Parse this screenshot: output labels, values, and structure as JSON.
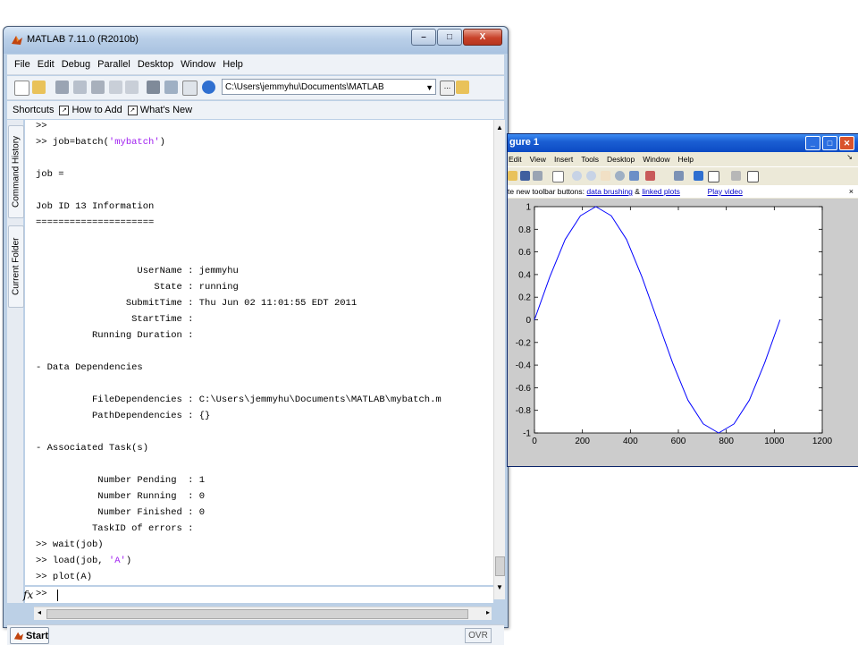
{
  "matlab": {
    "title": "MATLAB  7.11.0 (R2010b)",
    "window_buttons": {
      "minimize": "–",
      "maximize": "□",
      "close": "X"
    },
    "menus": [
      "File",
      "Edit",
      "Debug",
      "Parallel",
      "Desktop",
      "Window",
      "Help"
    ],
    "toolbar": {
      "current_folder": "C:\\Users\\jemmyhu\\Documents\\MATLAB",
      "browse": "..."
    },
    "shortcuts": {
      "label": "Shortcuts",
      "items": [
        "How to Add",
        "What's New"
      ]
    },
    "side_tabs": [
      "Command History",
      "Current Folder"
    ],
    "command_window": {
      "lines": [
        ">>",
        ">> job=batch('mybatch')",
        "",
        "job =",
        "",
        "Job ID 13 Information",
        "=====================",
        "",
        "",
        "                  UserName : jemmyhu",
        "                     State : running",
        "                SubmitTime : Thu Jun 02 11:01:55 EDT 2011",
        "                 StartTime :",
        "          Running Duration :",
        "",
        "- Data Dependencies",
        "",
        "          FileDependencies : C:\\Users\\jemmyhu\\Documents\\MATLAB\\mybatch.m",
        "          PathDependencies : {}",
        "",
        "- Associated Task(s)",
        "",
        "           Number Pending  : 1",
        "           Number Running  : 0",
        "           Number Finished : 0",
        "          TaskID of errors :",
        ">> wait(job)",
        ">> load(job, 'A')",
        ">> plot(A)"
      ],
      "prompt_fx": "fx",
      "prompt": ">>"
    },
    "status": {
      "start_label": "Start",
      "ovr": "OVR"
    }
  },
  "figure": {
    "title": "gure 1",
    "menus": [
      "Edit",
      "View",
      "Insert",
      "Tools",
      "Desktop",
      "Window",
      "Help"
    ],
    "tip": {
      "prefix": "te new toolbar buttons:",
      "link1": "data brushing",
      "amp": "&",
      "link2": "linked plots",
      "link3": "Play video",
      "close": "×"
    }
  },
  "chart_data": {
    "type": "line",
    "title": "",
    "xlabel": "",
    "ylabel": "",
    "xlim": [
      0,
      1200
    ],
    "ylim": [
      -1,
      1
    ],
    "xticks": [
      0,
      200,
      400,
      600,
      800,
      1000,
      1200
    ],
    "yticks": [
      1,
      0.8,
      0.6,
      0.4,
      0.2,
      0,
      -0.2,
      -0.4,
      -0.6,
      -0.8,
      -1
    ],
    "ytick_labels": [
      "1",
      "0.8",
      "0.6",
      "0.4",
      "0.2",
      "0",
      "-0.2",
      "-0.4",
      "-0.6",
      "-0.8",
      "-1"
    ],
    "grid": false,
    "series": [
      {
        "color": "#0000ff",
        "x": [
          0,
          64,
          128,
          192,
          256,
          320,
          384,
          448,
          512,
          576,
          640,
          704,
          768,
          832,
          896,
          960,
          1024
        ],
        "y": [
          0,
          0.38,
          0.71,
          0.92,
          1.0,
          0.92,
          0.71,
          0.38,
          0,
          -0.38,
          -0.71,
          -0.92,
          -1.0,
          -0.92,
          -0.71,
          -0.38,
          0
        ]
      }
    ]
  }
}
